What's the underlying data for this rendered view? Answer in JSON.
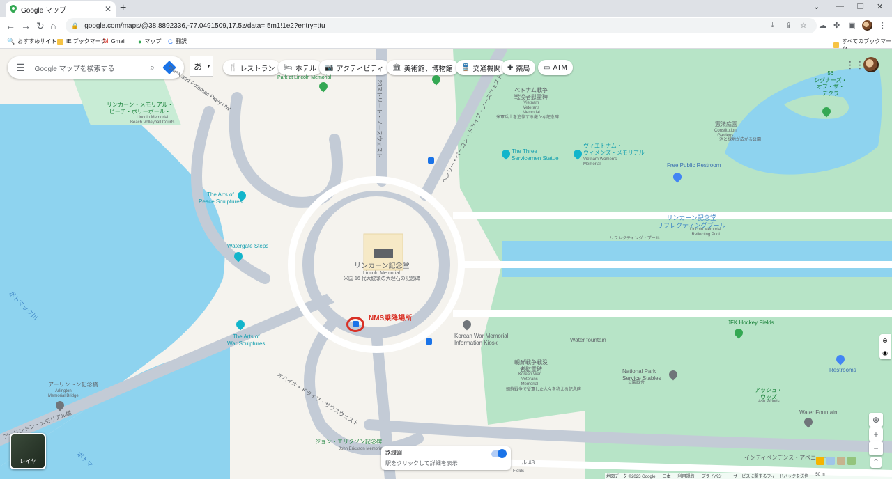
{
  "browser": {
    "tab_title": "Google マップ",
    "url": "google.com/maps/@38.8892336,-77.0491509,17.5z/data=!5m1!1e2?entry=ttu",
    "bookmarks": [
      "おすすめサイト",
      "IE ブックマーク",
      "Gmail",
      "マップ",
      "翻訳"
    ],
    "all_bookmarks": "すべてのブックマーク"
  },
  "search": {
    "placeholder": "Google マップを検索する"
  },
  "ime": {
    "label": "あ"
  },
  "chips": [
    "レストラン",
    "ホテル",
    "アクティビティ",
    "美術館、博物館",
    "交通機関",
    "薬局",
    "ATM"
  ],
  "map_labels": {
    "lincoln_memorial_ja": "リンカーン記念堂",
    "lincoln_memorial_en": "Lincoln Memorial",
    "lincoln_memorial_desc": "米国 16 代大統領の大理石の記念碑",
    "nms": "NMS乗降場所",
    "arts_of_peace": "The Arts of\nPeace Sculptures",
    "arts_of_war": "The Arts of\nWar Sculptures",
    "watergate_steps": "Watergate Steps",
    "korean_war_kiosk": "Korean War Memorial\nInformation Kiosk",
    "water_fountain": "Water fountain",
    "korean_war_memorial": "朝鮮戦争戦没\n者慰霊碑",
    "korean_war_memorial_en": "Korean War\nVeterans\nMemorial",
    "korean_war_memorial_desc": "朝鮮戦争で従軍した人々を称える記念碑",
    "jfk_hockey": "JFK Hockey Fields",
    "national_park_stables": "National Park\nService Stables",
    "national_park_stables_ja": "公園厩舎",
    "restrooms": "Restrooms",
    "ash_woods_ja": "アッシュ・\nウッズ",
    "ash_woods_en": "Ash Woods",
    "water_fountain2": "Water Fountain",
    "reflecting_pool_ja": "リンカーン記念堂\nリフレクティングプール",
    "reflecting_pool_en": "Lincoln Memorial\nReflecting Pool",
    "reflecting_pool_road": "リフレクティング・プール",
    "free_restroom": "Free Public Restroom",
    "three_servicemen": "The Three\nServicemen Statue",
    "vietnam_women": "ヴィエトナム・\nウィメンズ・メモリアル",
    "vietnam_women_en": "Vietnam Women's\nMemorial",
    "vietnam_memorial": "ベトナム戦争\n戦没者慰霊碑",
    "vietnam_memorial_en": "Vietnam\nVeterans\nMemorial",
    "vietnam_memorial_desc": "米軍兵士を追悼する厳かな記念碑",
    "constitution_gardens": "憲法庭園",
    "constitution_gardens_en": "Constitution\nGardens",
    "constitution_gardens_desc": "池と緑地が広がる公園",
    "signers": "56\nシグナーズ・\nオブ・ザ・\nデクラ",
    "beach_volley_ja": "リンカーン・メモリアル・\nビーチ・ボリーボール・",
    "beach_volley_en": "Lincoln Memorial\nBeach Volleyball Courts",
    "park_at_lincoln": "Park at Lincoln Memorial",
    "potomac_river": "ポトマック川",
    "arlington_bridge_ja": "アーリントン記念橋",
    "arlington_bridge_en": "Arlington\nMemorial Bridge",
    "memorial_bridge_road": "アーリントン・メモリアル橋",
    "potomac_pkwy": "Creek and Potomac Pkwy NW",
    "north_st": "23ストリート・ノースウェスト",
    "henry_bacon": "ヘンリー・ベーコン・ドライブ・ノースウェスト",
    "ohio_drive": "オハイオ・ドライブ・サウスウェスト",
    "independence": "インディペンデンス・アベニュー",
    "john_ericsson": "ジョン・エリクソン記念碑",
    "john_ericsson_en": "John Ericsson Memorial",
    "potomac2": "ポトマ",
    "hash8": "ル #8",
    "fields": "Fields"
  },
  "layers_label": "レイヤ",
  "route_card": {
    "title": "路線図",
    "subtitle": "駅をクリックして詳細を表示"
  },
  "footer": [
    "地図データ ©2023 Google",
    "日本",
    "利用規約",
    "プライバシー",
    "サービスに関するフィードバックを送信",
    "50 m"
  ]
}
